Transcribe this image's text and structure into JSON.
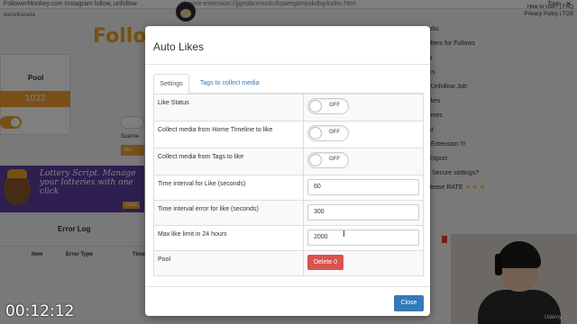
{
  "browser": {
    "tab_text": "FollowerMonkey.com Instagram follow, unfollow",
    "url": "chrome-extension://jjgnobcmmckcfcpaetgamjiakdbg/index.html",
    "user_link": "Twm",
    "close_glyph": "✕"
  },
  "background": {
    "username": "danielbarada",
    "brand": "Follow",
    "pool": {
      "title": "Pool",
      "value": "1033"
    },
    "scanner": {
      "label": "Scanne",
      "button": "Sto"
    },
    "banner": {
      "text": "Lottery Script. Manage your lotteries with one click",
      "badge": "FREE"
    },
    "error_log": {
      "title": "Error Log",
      "col_id": "Item",
      "col_type": "Error Type",
      "col_time": "Time"
    },
    "right_links": [
      "How to Use? | FAQ",
      "Privacy Policy | TOS"
    ],
    "side_menu": [
      "Jobs",
      "Filters for Follows",
      "gs",
      "tics",
      "e Unfollow Job",
      "Likes",
      "Times",
      "list",
      "d Extension !!!",
      "t/Export",
      "is Secure settings?",
      "Please RATE"
    ],
    "stars": "★ ★ ★",
    "video_brand": "Udemy",
    "timestamp": "00:12:12"
  },
  "modal": {
    "title": "Auto Likes",
    "tabs": [
      "Settings",
      "Tags to collect media"
    ],
    "rows": [
      {
        "label": "Like Status",
        "type": "switch",
        "value": "OFF"
      },
      {
        "label": "Collect media from Home Timeline to like",
        "type": "switch",
        "value": "OFF"
      },
      {
        "label": "Collect media from Tags to like",
        "type": "switch",
        "value": "OFF"
      },
      {
        "label": "Time interval for Like (seconds)",
        "type": "input",
        "value": "60"
      },
      {
        "label": "Time interval error for like (seconds)",
        "type": "input",
        "value": "300"
      },
      {
        "label": "Max like limit in 24 hours",
        "type": "input",
        "value": "2000"
      },
      {
        "label": "Pool",
        "type": "button",
        "value": "Delete 0"
      }
    ],
    "close_label": "Close",
    "cursor_glyph": "I"
  },
  "colors": {
    "accent_orange": "#f0a030",
    "primary_blue": "#337ab7",
    "danger_red": "#d9534f"
  }
}
